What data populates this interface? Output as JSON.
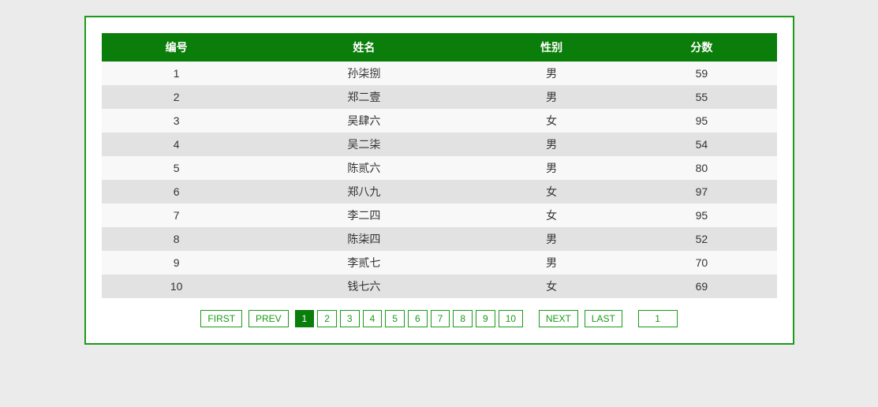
{
  "table": {
    "headers": [
      "编号",
      "姓名",
      "性别",
      "分数"
    ],
    "rows": [
      {
        "id": "1",
        "name": "孙柒捌",
        "gender": "男",
        "score": "59"
      },
      {
        "id": "2",
        "name": "郑二壹",
        "gender": "男",
        "score": "55"
      },
      {
        "id": "3",
        "name": "吴肆六",
        "gender": "女",
        "score": "95"
      },
      {
        "id": "4",
        "name": "吴二柒",
        "gender": "男",
        "score": "54"
      },
      {
        "id": "5",
        "name": "陈贰六",
        "gender": "男",
        "score": "80"
      },
      {
        "id": "6",
        "name": "郑八九",
        "gender": "女",
        "score": "97"
      },
      {
        "id": "7",
        "name": "李二四",
        "gender": "女",
        "score": "95"
      },
      {
        "id": "8",
        "name": "陈柒四",
        "gender": "男",
        "score": "52"
      },
      {
        "id": "9",
        "name": "李贰七",
        "gender": "男",
        "score": "70"
      },
      {
        "id": "10",
        "name": "钱七六",
        "gender": "女",
        "score": "69"
      }
    ]
  },
  "pagination": {
    "first_label": "FIRST",
    "prev_label": "PREV",
    "next_label": "NEXT",
    "last_label": "LAST",
    "pages": [
      "1",
      "2",
      "3",
      "4",
      "5",
      "6",
      "7",
      "8",
      "9",
      "10"
    ],
    "active_page": "1",
    "page_input_value": "1"
  }
}
